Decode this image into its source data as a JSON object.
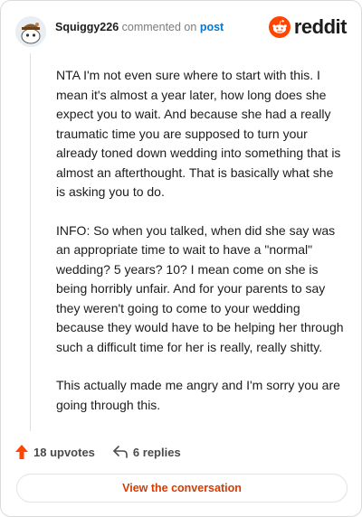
{
  "comment": {
    "username": "Squiggy226",
    "action_text": "commented on",
    "link_text": "post",
    "paragraphs": [
      "NTA I'm not even sure where to start with this. I mean it's almost a year later, how long does she expect you to wait. And because she had a really traumatic time you are supposed to turn your already toned down wedding into something that is almost an afterthought. That is basically what she is asking you to do.",
      "INFO: So when you talked, when did she say was an appropriate time to wait to have a \"normal\" wedding? 5 years? 10? I mean come on she is being horribly unfair. And for your parents to say they weren't going to come to your wedding because they would have to be helping her through such a difficult time for her is really, really shitty.",
      "This actually made me angry and I'm sorry you are going through this."
    ]
  },
  "brand": {
    "logo_text": "reddit",
    "color": "#ff4500"
  },
  "footer": {
    "upvotes_label": "18 upvotes",
    "replies_label": "6 replies",
    "upvote_color": "#ff4500"
  },
  "cta": {
    "label": "View the conversation",
    "color": "#d93a00"
  }
}
